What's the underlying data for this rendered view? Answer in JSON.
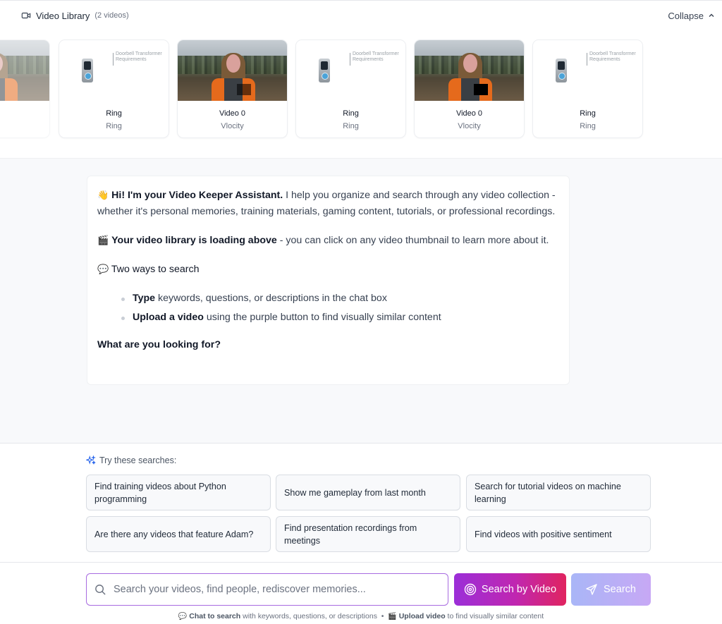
{
  "library": {
    "title": "Video Library",
    "count": "(2 videos)",
    "collapse_label": "Collapse",
    "videos": [
      {
        "title": "Ring",
        "subtitle": "Ring",
        "thumb": "doorbell-document",
        "caption": "Doorbell Transformer Requirements"
      },
      {
        "title": "Video 0",
        "subtitle": "Vlocity",
        "thumb": "person-outdoors"
      },
      {
        "title": "Ring",
        "subtitle": "Ring",
        "thumb": "doorbell-document",
        "caption": "Doorbell Transformer Requirements"
      },
      {
        "title": "Video 0",
        "subtitle": "Vlocity",
        "thumb": "person-outdoors"
      },
      {
        "title": "Ring",
        "subtitle": "Ring",
        "thumb": "doorbell-document",
        "caption": "Doorbell Transformer Requirements"
      }
    ]
  },
  "assistant": {
    "greeting_emoji": "👋",
    "greeting_bold": "Hi! I'm your Video Keeper Assistant.",
    "greeting_rest": " I help you organize and search through any video collection - whether it's personal memories, training materials, gaming content, tutorials, or professional recordings.",
    "loading_emoji": "🎬",
    "loading_bold": "Your video library is loading above",
    "loading_rest": " - you can click on any video thumbnail to learn more about it.",
    "ways_emoji": "💬",
    "ways_title": "Two ways to search",
    "bullet1_bold": "Type",
    "bullet1_rest": " keywords, questions, or descriptions in the chat box",
    "bullet2_bold": "Upload a video",
    "bullet2_rest": " using the purple button to find visually similar content",
    "question": "What are you looking for?"
  },
  "suggestions": {
    "heading": "Try these searches:",
    "items": [
      "Find training videos about Python programming",
      "Show me gameplay from last month",
      "Search for tutorial videos on machine learning",
      "Are there any videos that feature Adam?",
      "Find presentation recordings from meetings",
      "Find videos with positive sentiment"
    ]
  },
  "input": {
    "placeholder": "Search your videos, find people, rediscover memories...",
    "search_by_video_label": "Search by Video",
    "search_label": "Search"
  },
  "hint": {
    "chat_emoji": "💬",
    "chat_bold": "Chat to search",
    "chat_rest": " with keywords, questions, or descriptions",
    "separator": "•",
    "upload_emoji": "🎬",
    "upload_bold": "Upload video",
    "upload_rest": " to find visually similar content"
  },
  "colors": {
    "accent_purple": "#9b2fd8",
    "accent_pink": "#e0245f",
    "input_border": "#a86be0"
  }
}
